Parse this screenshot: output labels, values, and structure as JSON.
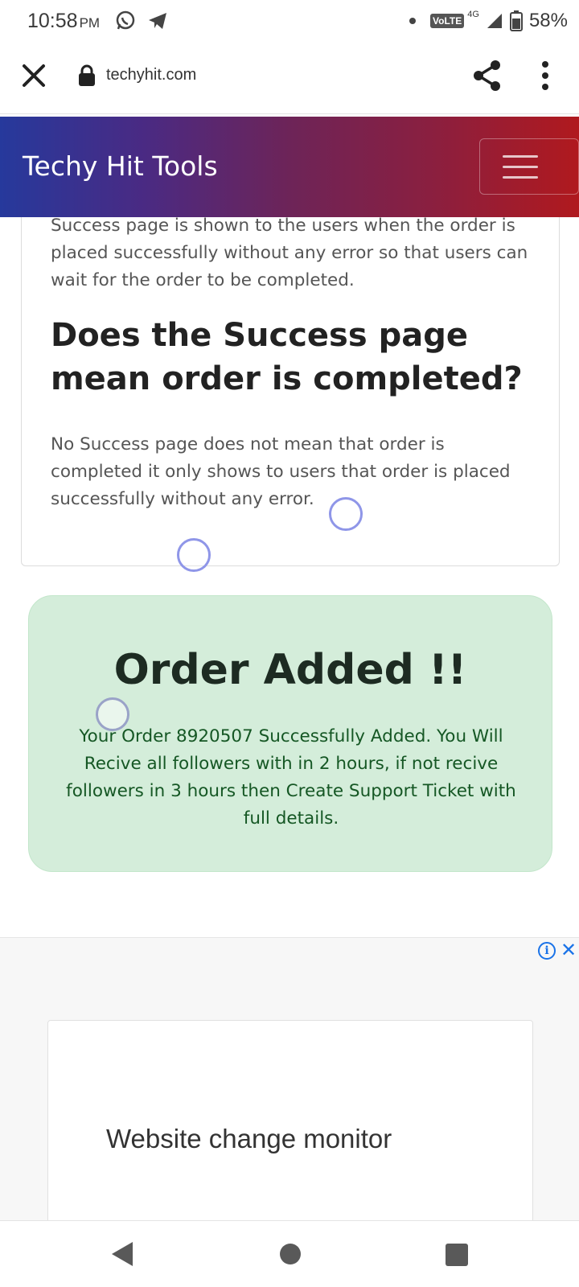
{
  "status_bar": {
    "time": "10:58",
    "ampm": "PM",
    "app_icons": [
      "whatsapp-icon",
      "telegram-icon"
    ],
    "volte": "VoLTE",
    "network": "4G",
    "battery": "58%"
  },
  "browser": {
    "url": "techyhit.com"
  },
  "site": {
    "title": "Techy Hit Tools"
  },
  "article": {
    "paragraph_1": "Success page is shown to the users when the order is placed successfully without any error so that users can wait for the order to be completed.",
    "heading": "Does the Success page mean order is completed?",
    "paragraph_2": "No Success page does not mean that order is completed it only shows to users that order is placed successfully without any error."
  },
  "alert": {
    "title": "Order Added !!",
    "message": "Your Order 8920507 Successfully Added. You Will Recive all followers with in 2 hours, if not recive followers in 3 hours then Create Support Ticket with full details."
  },
  "ad": {
    "info_label": "i",
    "close_label": "✕",
    "title": "Website change monitor"
  },
  "colors": {
    "header_gradient_start": "#26399c",
    "header_gradient_end": "#b0191e",
    "alert_background": "#d4edda",
    "alert_text": "#155724"
  }
}
